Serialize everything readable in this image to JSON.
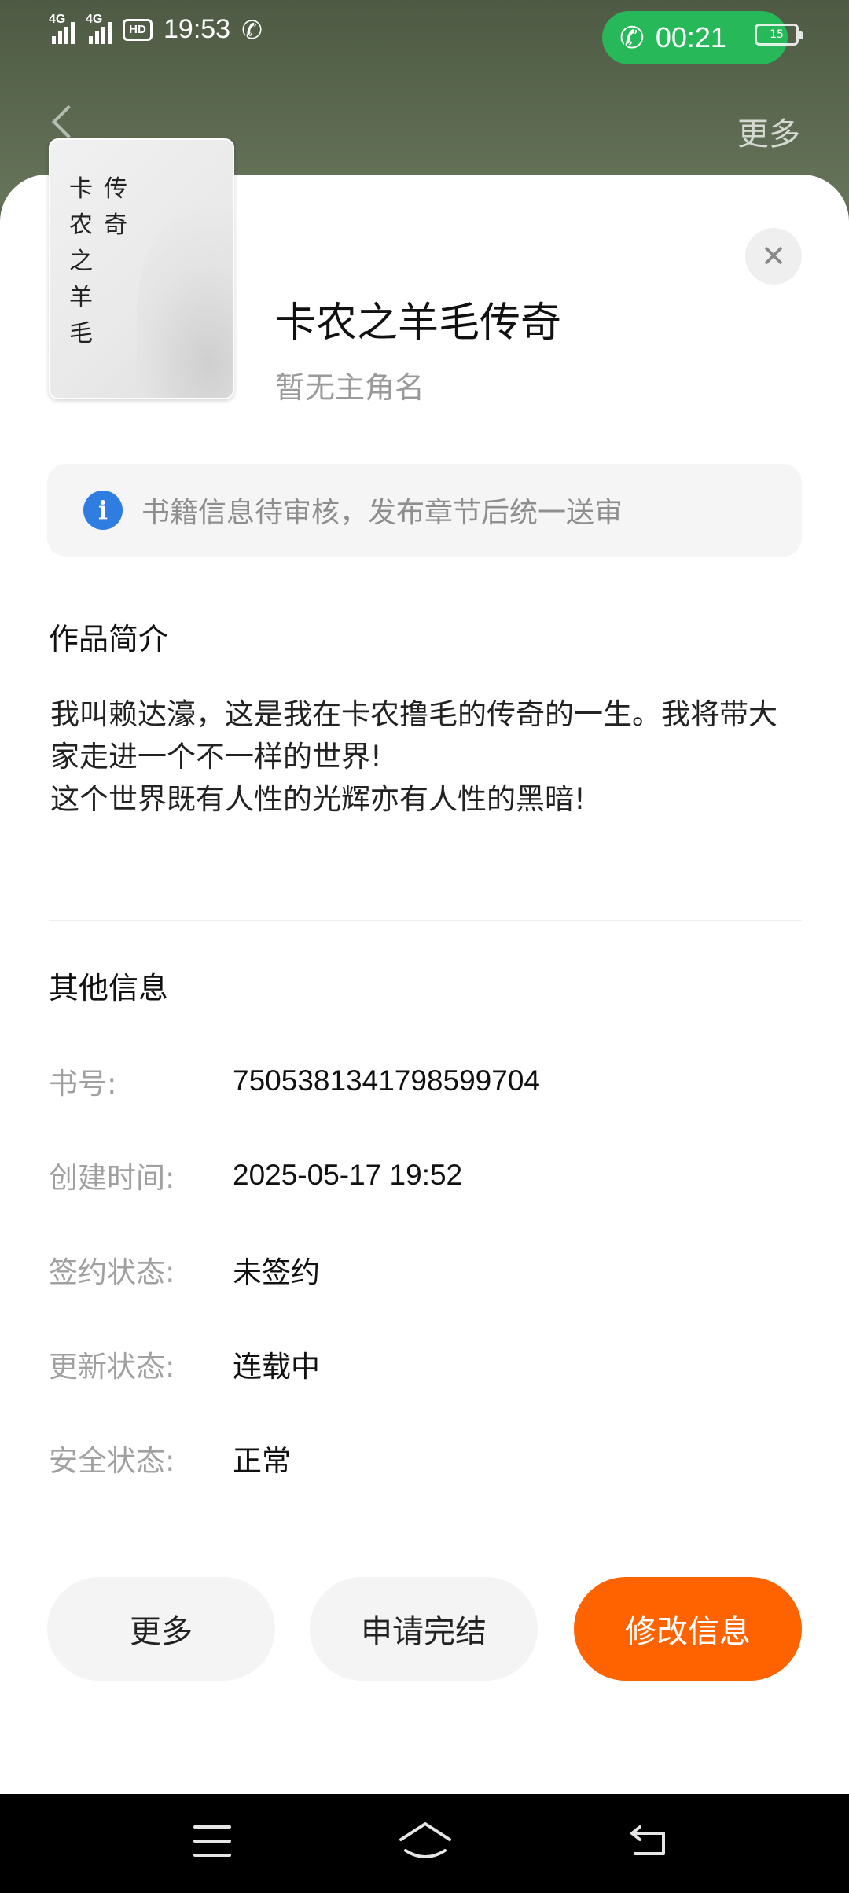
{
  "status_bar": {
    "signal1": "4G",
    "signal2": "4G",
    "hd": "HD",
    "time": "19:53",
    "call_timer": "00:21",
    "battery": "15"
  },
  "header": {
    "more": "更多"
  },
  "book": {
    "cover_title_col1": [
      "卡",
      "农",
      "之",
      "羊",
      "毛"
    ],
    "cover_title_col2": [
      "传",
      "奇"
    ],
    "title": "卡农之羊毛传奇",
    "protagonist": "暂无主角名",
    "notice": "书籍信息待审核，发布章节后统一送审"
  },
  "intro": {
    "heading": "作品简介",
    "line1": "我叫赖达濠，这是我在卡农撸毛的传奇的一生。我将带大家走进一个不一样的世界!",
    "line2": "这个世界既有人性的光辉亦有人性的黑暗!"
  },
  "other_info": {
    "heading": "其他信息",
    "rows": [
      {
        "label": "书号:",
        "value": "7505381341798599704"
      },
      {
        "label": "创建时间:",
        "value": "2025-05-17 19:52"
      },
      {
        "label": "签约状态:",
        "value": "未签约"
      },
      {
        "label": "更新状态:",
        "value": "连载中"
      },
      {
        "label": "安全状态:",
        "value": "正常"
      }
    ]
  },
  "actions": {
    "more": "更多",
    "apply_complete": "申请完结",
    "edit_info": "修改信息"
  },
  "colors": {
    "accent": "#ff6300",
    "info_icon": "#2f7de1",
    "call_pill": "#27b85a"
  },
  "icons": [
    "back-icon",
    "close-icon",
    "info-icon",
    "phone-icon",
    "menu-icon",
    "home-icon",
    "back-nav-icon"
  ]
}
